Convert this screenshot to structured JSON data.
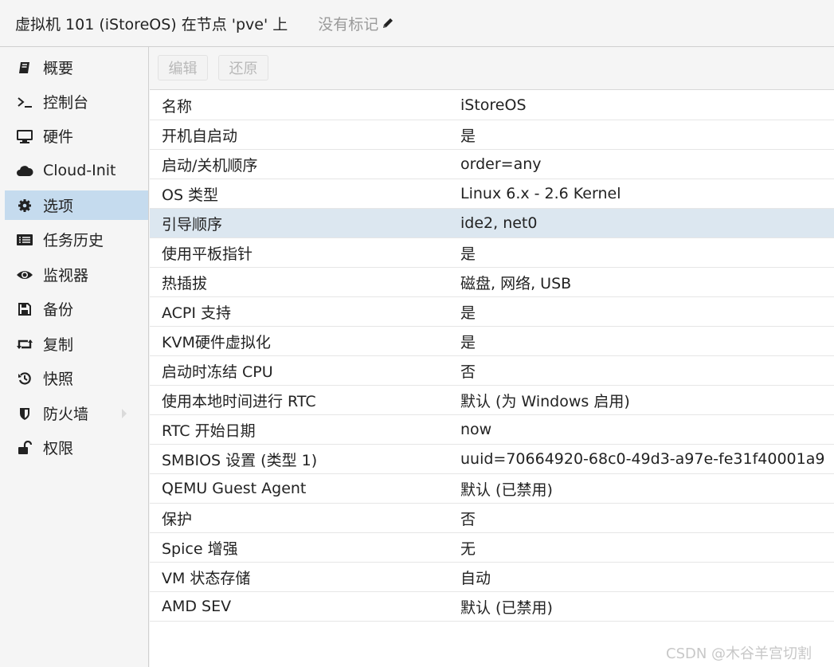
{
  "header": {
    "title": "虚拟机 101 (iStoreOS) 在节点 'pve' 上",
    "tags": "没有标记"
  },
  "sidebar": {
    "items": [
      {
        "label": "概要",
        "icon": "book-icon"
      },
      {
        "label": "控制台",
        "icon": "terminal-icon"
      },
      {
        "label": "硬件",
        "icon": "monitor-icon"
      },
      {
        "label": "Cloud-Init",
        "icon": "cloud-icon"
      },
      {
        "label": "选项",
        "icon": "gear-icon"
      },
      {
        "label": "任务历史",
        "icon": "list-icon"
      },
      {
        "label": "监视器",
        "icon": "eye-icon"
      },
      {
        "label": "备份",
        "icon": "floppy-icon"
      },
      {
        "label": "复制",
        "icon": "retweet-icon"
      },
      {
        "label": "快照",
        "icon": "history-icon"
      },
      {
        "label": "防火墙",
        "icon": "shield-icon"
      },
      {
        "label": "权限",
        "icon": "unlock-icon"
      }
    ],
    "active_index": 4
  },
  "toolbar": {
    "edit_label": "编辑",
    "revert_label": "还原"
  },
  "options": {
    "rows": [
      {
        "key": "名称",
        "value": "iStoreOS"
      },
      {
        "key": "开机自启动",
        "value": "是"
      },
      {
        "key": "启动/关机顺序",
        "value": "order=any"
      },
      {
        "key": "OS 类型",
        "value": "Linux 6.x - 2.6 Kernel"
      },
      {
        "key": "引导顺序",
        "value": "ide2, net0"
      },
      {
        "key": "使用平板指针",
        "value": "是"
      },
      {
        "key": "热插拔",
        "value": "磁盘, 网络, USB"
      },
      {
        "key": "ACPI 支持",
        "value": "是"
      },
      {
        "key": "KVM硬件虚拟化",
        "value": "是"
      },
      {
        "key": "启动时冻结 CPU",
        "value": "否"
      },
      {
        "key": "使用本地时间进行 RTC",
        "value": "默认 (为 Windows 启用)"
      },
      {
        "key": "RTC 开始日期",
        "value": "now"
      },
      {
        "key": "SMBIOS 设置 (类型 1)",
        "value": "uuid=70664920-68c0-49d3-a97e-fe31f40001a9"
      },
      {
        "key": "QEMU Guest Agent",
        "value": "默认 (已禁用)"
      },
      {
        "key": "保护",
        "value": "否"
      },
      {
        "key": "Spice 增强",
        "value": "无"
      },
      {
        "key": "VM 状态存储",
        "value": "自动"
      },
      {
        "key": "AMD SEV",
        "value": "默认 (已禁用)"
      }
    ],
    "selected_index": 4
  },
  "watermark": "CSDN @木谷羊宫切割"
}
